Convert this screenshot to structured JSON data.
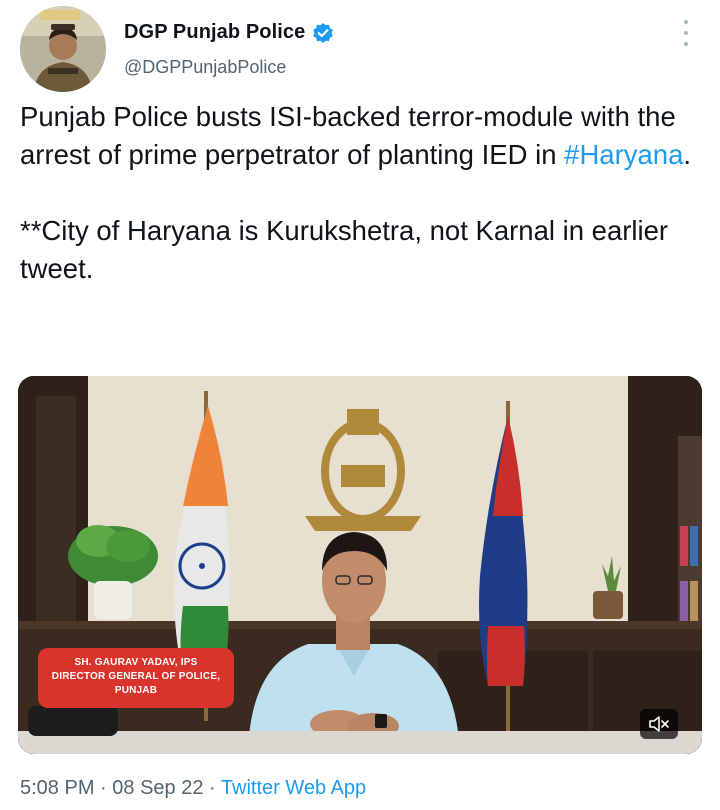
{
  "author": {
    "display_name": "DGP Punjab Police",
    "handle": "@DGPPunjabPolice",
    "verified": true
  },
  "icons": {
    "verified": "verified-badge-icon",
    "more": "more-options-icon",
    "mute": "muted-speaker-icon"
  },
  "tweet": {
    "text_part1": "Punjab Police busts ISI-backed terror-module with the arrest of prime perpetrator of planting IED in ",
    "hashtag": "#Haryana",
    "text_part1_end": ".",
    "text_part2": "**City of Haryana is Kurukshetra, not Karnal in earlier tweet."
  },
  "media": {
    "caption_line1": "SH. GAURAV YADAV, IPS",
    "caption_line2": "DIRECTOR GENERAL OF POLICE,",
    "caption_line3": "PUNJAB"
  },
  "meta": {
    "time": "5:08 PM",
    "separator1": " · ",
    "date": "08 Sep 22",
    "separator2": " · ",
    "app": "Twitter Web App"
  },
  "colors": {
    "accent": "#1d9bf0",
    "text": "#0f1419",
    "muted": "#536471",
    "caption_bg": "#d9342b"
  }
}
